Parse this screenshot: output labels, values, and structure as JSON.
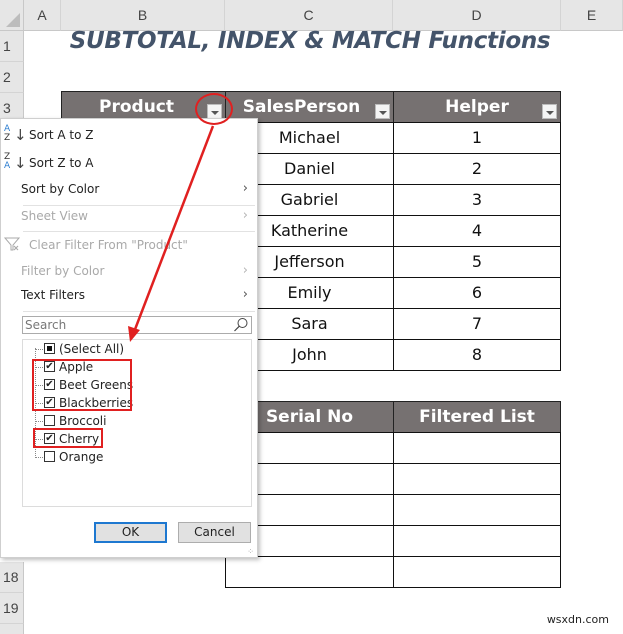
{
  "sheet": {
    "columns": [
      "A",
      "B",
      "C",
      "D",
      "E"
    ],
    "rows": [
      "1",
      "2",
      "3",
      "18",
      "19"
    ],
    "title": "SUBTOTAL, INDEX & MATCH Functions"
  },
  "table1": {
    "headers": [
      "Product",
      "SalesPerson",
      "Helper"
    ],
    "rows": [
      {
        "salesperson": "Michael",
        "helper": "1"
      },
      {
        "salesperson": "Daniel",
        "helper": "2"
      },
      {
        "salesperson": "Gabriel",
        "helper": "3"
      },
      {
        "salesperson": "Katherine",
        "helper": "4"
      },
      {
        "salesperson": "Jefferson",
        "helper": "5"
      },
      {
        "salesperson": "Emily",
        "helper": "6"
      },
      {
        "salesperson": "Sara",
        "helper": "7"
      },
      {
        "salesperson": "John",
        "helper": "8"
      }
    ]
  },
  "table2": {
    "headers": [
      "Serial No",
      "Filtered List"
    ],
    "row_count": 5
  },
  "filter_menu": {
    "items": [
      {
        "label": "Sort A to Z",
        "icon": "sort-a-z-icon",
        "enabled": true,
        "submenu": false
      },
      {
        "label": "Sort Z to A",
        "icon": "sort-z-a-icon",
        "enabled": true,
        "submenu": false
      },
      {
        "label": "Sort by Color",
        "enabled": true,
        "submenu": true
      },
      {
        "label": "Sheet View",
        "enabled": false,
        "submenu": true
      },
      {
        "label": "Clear Filter From \"Product\"",
        "icon": "clear-filter-icon",
        "enabled": false,
        "submenu": false
      },
      {
        "label": "Filter by Color",
        "enabled": false,
        "submenu": true
      },
      {
        "label": "Text Filters",
        "enabled": true,
        "submenu": true
      }
    ],
    "search_placeholder": "Search",
    "list": [
      {
        "label": "(Select All)",
        "state": "partial"
      },
      {
        "label": "Apple",
        "state": "checked"
      },
      {
        "label": "Beet Greens",
        "state": "checked"
      },
      {
        "label": "Blackberries",
        "state": "checked"
      },
      {
        "label": "Broccoli",
        "state": "unchecked"
      },
      {
        "label": "Cherry",
        "state": "checked"
      },
      {
        "label": "Orange",
        "state": "unchecked"
      }
    ],
    "ok_label": "OK",
    "cancel_label": "Cancel"
  },
  "annotation_color": "#e02020",
  "watermark": "wsxdn.com"
}
